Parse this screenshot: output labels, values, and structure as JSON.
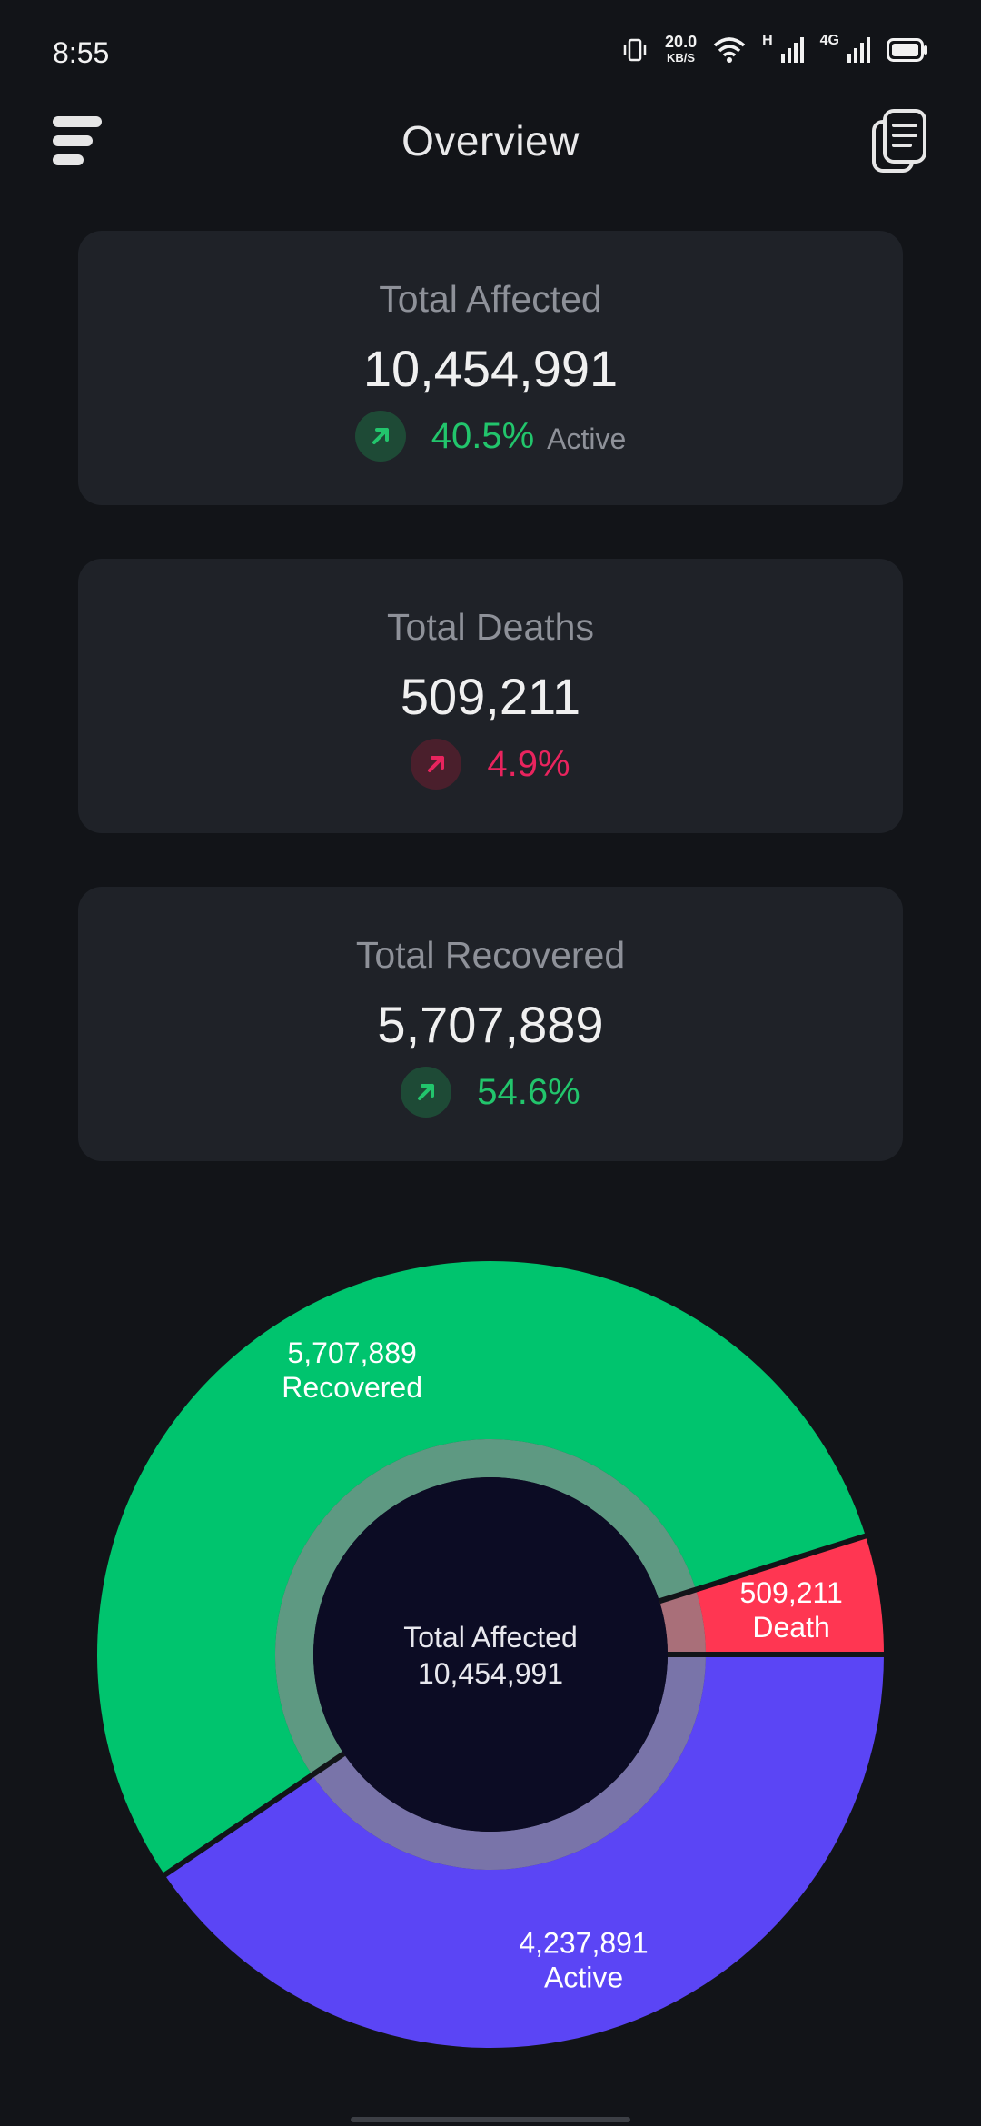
{
  "status_bar": {
    "time": "8:55",
    "net_speed_value": "20.0",
    "net_speed_unit": "KB/S",
    "sim1_label": "H",
    "sim2_label": "4G",
    "icons": [
      "vibrate-icon",
      "wifi-icon",
      "signal-icon",
      "signal-4g-icon",
      "battery-icon"
    ]
  },
  "header": {
    "title": "Overview",
    "menu_icon": "menu-icon",
    "report_icon": "document-icon"
  },
  "cards": [
    {
      "label": "Total Affected",
      "value": "10,454,991",
      "percent": "40.5%",
      "suffix": "Active",
      "color": "#22c56c"
    },
    {
      "label": "Total Deaths",
      "value": "509,211",
      "percent": "4.9%",
      "suffix": "",
      "color": "#e9245e"
    },
    {
      "label": "Total Recovered",
      "value": "5,707,889",
      "percent": "54.6%",
      "suffix": "",
      "color": "#22c56c"
    }
  ],
  "chart_data": {
    "type": "pie",
    "center_title": "Total Affected",
    "center_value": "10,454,991",
    "series": [
      {
        "name": "Recovered",
        "label": "5,707,889",
        "value": 5707889,
        "color": "#00c46e"
      },
      {
        "name": "Death",
        "label": "509,211",
        "value": 509211,
        "color": "#ff3652"
      },
      {
        "name": "Active",
        "label": "4,237,891",
        "value": 4237891,
        "color": "#5b45f5"
      }
    ]
  }
}
